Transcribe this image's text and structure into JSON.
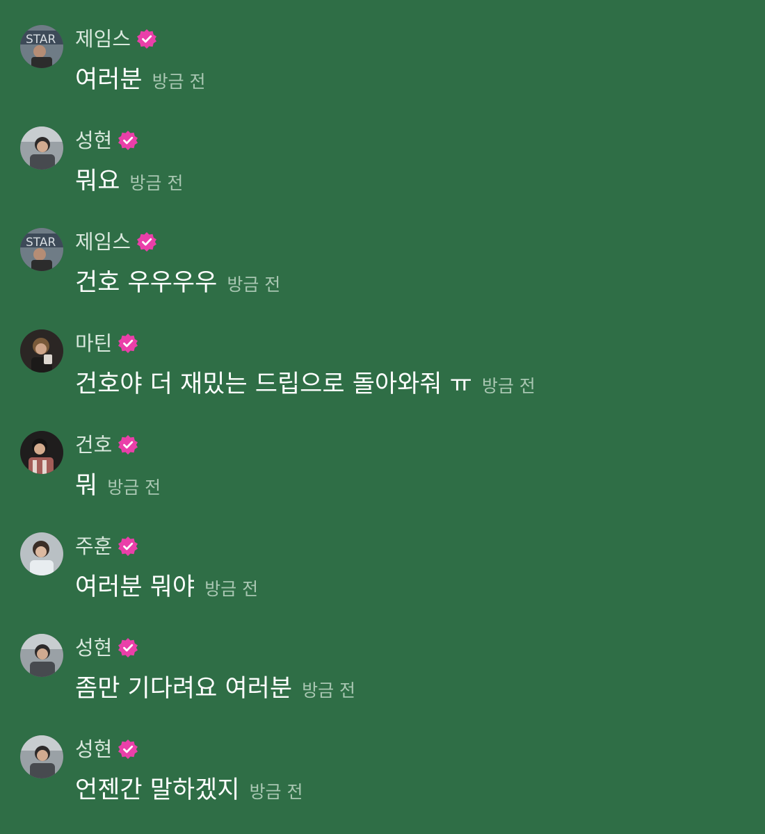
{
  "messages": [
    {
      "name": "제임스",
      "text": "여러분",
      "time": "방금 전",
      "avatar": "avatar-james"
    },
    {
      "name": "성현",
      "text": "뭐요",
      "time": "방금 전",
      "avatar": "avatar-sunghyun"
    },
    {
      "name": "제임스",
      "text": "건호 우우우우",
      "time": "방금 전",
      "avatar": "avatar-james"
    },
    {
      "name": "마틴",
      "text": "건호야 더 재밌는 드립으로 돌아와줘 ㅠ",
      "time": "방금 전",
      "avatar": "avatar-martin"
    },
    {
      "name": "건호",
      "text": "뭐",
      "time": "방금 전",
      "avatar": "avatar-geonho"
    },
    {
      "name": "주훈",
      "text": "여러분 뭐야",
      "time": "방금 전",
      "avatar": "avatar-juhoon"
    },
    {
      "name": "성현",
      "text": "좀만 기다려요 여러분",
      "time": "방금 전",
      "avatar": "avatar-sunghyun"
    },
    {
      "name": "성현",
      "text": "언젠간 말하겠지",
      "time": "방금 전",
      "avatar": "avatar-sunghyun"
    }
  ],
  "colors": {
    "background": "#2f6e46",
    "name_text": "#d9e8dd",
    "message_text": "#ffffff",
    "time_text": "#a9c7b2",
    "verified_badge": "#ea3fa9"
  },
  "icons": {
    "verified": "verified-badge-icon"
  }
}
